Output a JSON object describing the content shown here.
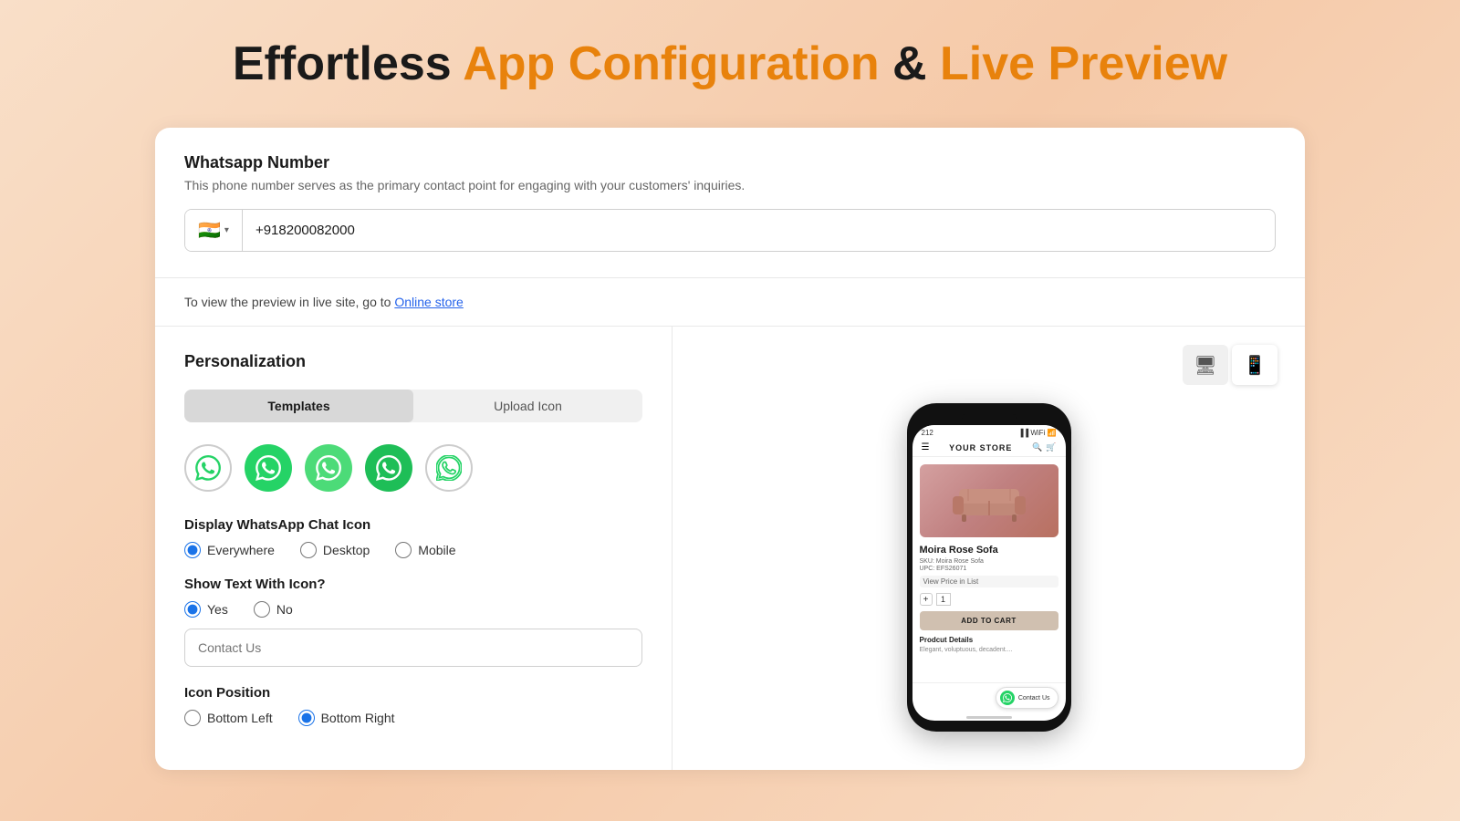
{
  "page": {
    "title_part1": "Effortless ",
    "title_part2": "App Configuration",
    "title_part3": " & ",
    "title_part4": "Live Preview"
  },
  "whatsapp_section": {
    "title": "Whatsapp Number",
    "description": "This phone number serves as the primary contact point for engaging with your customers' inquiries.",
    "flag": "🇮🇳",
    "phone": "+918200082000"
  },
  "preview_link": {
    "text": "To view the preview in live site, go to ",
    "link_label": "Online store"
  },
  "personalization": {
    "panel_title": "Personalization",
    "tabs": {
      "templates_label": "Templates",
      "upload_label": "Upload Icon"
    },
    "display_section": {
      "title": "Display WhatsApp Chat Icon",
      "options": [
        "Everywhere",
        "Desktop",
        "Mobile"
      ],
      "selected": "Everywhere"
    },
    "show_text_section": {
      "title": "Show Text With Icon?",
      "options": [
        "Yes",
        "No"
      ],
      "selected": "Yes"
    },
    "contact_text_placeholder": "Contact Us",
    "position_section": {
      "title": "Icon Position",
      "options": [
        "Bottom Left",
        "Bottom Right"
      ],
      "selected": "Bottom Right"
    }
  },
  "preview": {
    "store_name": "YOUR STORE",
    "product": {
      "name": "Moira Rose Sofa",
      "sku": "SKU: Moira Rose Sofa",
      "upc": "UPC: EFS26071",
      "qty": "1",
      "btn_label": "ADD TO CART",
      "details_label": "Prodcut Details",
      "details_text": "Elegant, voluptuous, decadent...."
    },
    "contact_chip": "Contact Us"
  },
  "icons": {
    "monitor": "🖥",
    "mobile": "📱",
    "whatsapp": "●",
    "search": "🔍",
    "cart": "🛒",
    "menu": "☰"
  }
}
